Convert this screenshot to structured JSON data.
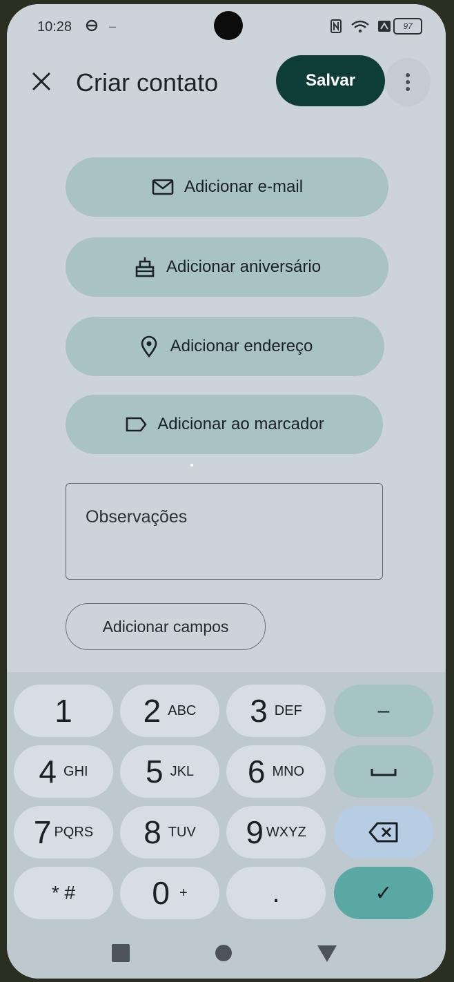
{
  "status_bar": {
    "time": "10:28",
    "battery": "97"
  },
  "app_bar": {
    "title": "Criar contato",
    "save_label": "Salvar"
  },
  "actions": [
    {
      "label": "Adicionar e-mail",
      "icon": "mail-icon"
    },
    {
      "label": "Adicionar aniversário",
      "icon": "cake-icon"
    },
    {
      "label": "Adicionar endereço",
      "icon": "location-pin-icon"
    },
    {
      "label": "Adicionar ao marcador",
      "icon": "label-icon"
    }
  ],
  "notes": {
    "placeholder": "Observações"
  },
  "add_fields_label": "Adicionar campos",
  "keyboard": {
    "rows": [
      [
        {
          "main": "1",
          "sub": ""
        },
        {
          "main": "2",
          "sub": "ABC"
        },
        {
          "main": "3",
          "sub": "DEF"
        },
        {
          "main": "–",
          "sub": ""
        }
      ],
      [
        {
          "main": "4",
          "sub": "GHI"
        },
        {
          "main": "5",
          "sub": "JKL"
        },
        {
          "main": "6",
          "sub": "MNO"
        },
        {
          "main": "␣",
          "sub": ""
        }
      ],
      [
        {
          "main": "7",
          "sub": "PQRS"
        },
        {
          "main": "8",
          "sub": "TUV"
        },
        {
          "main": "9",
          "sub": "WXYZ"
        },
        {
          "main": "⌫",
          "sub": ""
        }
      ],
      [
        {
          "main": "* #",
          "sub": ""
        },
        {
          "main": "0",
          "sub": "+"
        },
        {
          "main": ".",
          "sub": ""
        },
        {
          "main": "✓",
          "sub": ""
        }
      ]
    ]
  },
  "colors": {
    "save_button": "#0e3d37",
    "pill": "#a9c2c4",
    "confirm_key": "#5aa8a3"
  }
}
